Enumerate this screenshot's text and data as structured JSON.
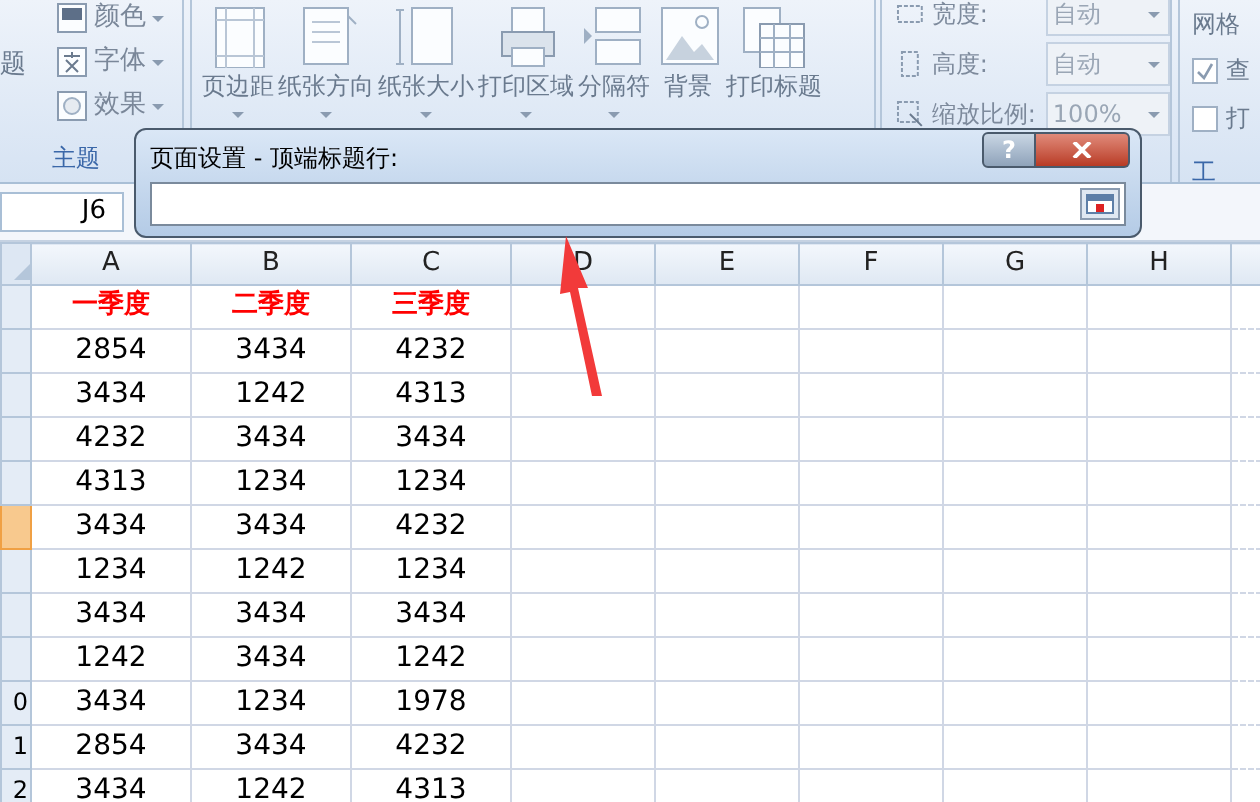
{
  "ribbon": {
    "groups": [
      {
        "kind": "theme",
        "big_button": "题",
        "items": [
          "颜色",
          "字体",
          "效果"
        ],
        "label": "主题"
      },
      {
        "kind": "page_setup",
        "buttons": [
          {
            "label": "页边距",
            "dropdown": true
          },
          {
            "label": "纸张方向",
            "dropdown": true
          },
          {
            "label": "纸张大小",
            "dropdown": true
          },
          {
            "label": "打印区域",
            "dropdown": true
          },
          {
            "label": "分隔符",
            "dropdown": true
          },
          {
            "label": "背景",
            "dropdown": false
          },
          {
            "label": "打印标题",
            "dropdown": false
          }
        ]
      },
      {
        "kind": "scale",
        "fields": [
          {
            "label": "宽度:",
            "value": "自动"
          },
          {
            "label": "高度:",
            "value": "自动"
          },
          {
            "label": "缩放比例:",
            "value": "100%"
          }
        ]
      },
      {
        "kind": "sheet_options",
        "title": "网格",
        "checks": [
          {
            "label": "查",
            "checked": true
          },
          {
            "label": "打",
            "checked": false
          }
        ],
        "label": "工"
      }
    ]
  },
  "name_box": "J6",
  "dialog": {
    "title": "页面设置 - 顶端标题行:",
    "help": "?"
  },
  "sheet": {
    "columns": [
      "A",
      "B",
      "C",
      "D",
      "E",
      "F",
      "G",
      "H"
    ],
    "rows": [
      {
        "kind": "heading",
        "selected": false,
        "cells": [
          "一季度",
          "二季度",
          "三季度"
        ]
      },
      {
        "kind": "data",
        "selected": false,
        "cells": [
          "2854",
          "3434",
          "4232"
        ]
      },
      {
        "kind": "data",
        "selected": false,
        "cells": [
          "3434",
          "1242",
          "4313"
        ]
      },
      {
        "kind": "data",
        "selected": false,
        "cells": [
          "4232",
          "3434",
          "3434"
        ]
      },
      {
        "kind": "data",
        "selected": false,
        "cells": [
          "4313",
          "1234",
          "1234"
        ]
      },
      {
        "kind": "data",
        "selected": true,
        "cells": [
          "3434",
          "3434",
          "4232"
        ]
      },
      {
        "kind": "data",
        "selected": false,
        "cells": [
          "1234",
          "1242",
          "1234"
        ]
      },
      {
        "kind": "data",
        "selected": false,
        "cells": [
          "3434",
          "3434",
          "3434"
        ]
      },
      {
        "kind": "data",
        "selected": false,
        "cells": [
          "1242",
          "3434",
          "1242"
        ]
      },
      {
        "kind": "data",
        "selected": false,
        "number": "0",
        "cells": [
          "3434",
          "1234",
          "1978"
        ]
      },
      {
        "kind": "data",
        "selected": false,
        "number": "1",
        "cells": [
          "2854",
          "3434",
          "4232"
        ]
      },
      {
        "kind": "data",
        "selected": false,
        "number": "2",
        "cells": [
          "3434",
          "1242",
          "4313"
        ]
      }
    ]
  }
}
